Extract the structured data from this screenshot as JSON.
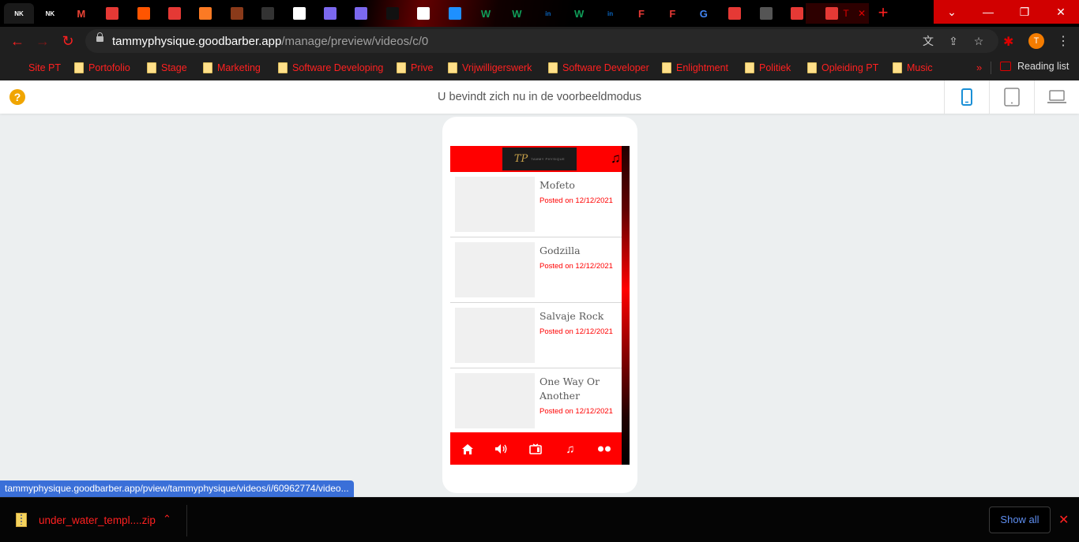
{
  "browser": {
    "tabs": [
      {
        "icon": "nkh-icon",
        "glyph": "NK",
        "color": "#ffffff"
      },
      {
        "icon": "nkh-icon",
        "glyph": "NK",
        "color": "#ffffff"
      },
      {
        "icon": "gmail-icon",
        "glyph": "M",
        "color": "#ea4335"
      },
      {
        "icon": "app-icon",
        "glyph": "",
        "color": "#e53935"
      },
      {
        "icon": "soundcloud-icon",
        "glyph": "",
        "color": "#ff5500"
      },
      {
        "icon": "app-icon",
        "glyph": "",
        "color": "#e53935"
      },
      {
        "icon": "xampp-icon",
        "glyph": "",
        "color": "#fb7a24"
      },
      {
        "icon": "bookmark-site-icon",
        "glyph": "",
        "color": "#8a3a1a"
      },
      {
        "icon": "dark-site-icon",
        "glyph": "",
        "color": "#333333"
      },
      {
        "icon": "github-icon",
        "glyph": "",
        "color": "#ffffff"
      },
      {
        "icon": "linear-icon",
        "glyph": "",
        "color": "#7b68ee"
      },
      {
        "icon": "linear-icon",
        "glyph": "",
        "color": "#7b68ee"
      },
      {
        "icon": "circle-icon",
        "glyph": "",
        "color": "#111111"
      },
      {
        "icon": "github-icon",
        "glyph": "",
        "color": "#ffffff"
      },
      {
        "icon": "drop-icon",
        "glyph": "",
        "color": "#1e90ff"
      },
      {
        "icon": "w-icon",
        "glyph": "W",
        "color": "#0f9d58"
      },
      {
        "icon": "w-icon",
        "glyph": "W",
        "color": "#0f9d58"
      },
      {
        "icon": "linkedin-icon",
        "glyph": "in",
        "color": "#0a66c2"
      },
      {
        "icon": "w-icon",
        "glyph": "W",
        "color": "#0f9d58"
      },
      {
        "icon": "linkedin-icon",
        "glyph": "in",
        "color": "#0a66c2"
      },
      {
        "icon": "f-icon",
        "glyph": "F",
        "color": "#e53935"
      },
      {
        "icon": "f-icon",
        "glyph": "F",
        "color": "#e53935"
      },
      {
        "icon": "google-icon",
        "glyph": "G",
        "color": "#4285f4"
      },
      {
        "icon": "record-icon",
        "glyph": "",
        "color": "#e53935"
      },
      {
        "icon": "loading-icon",
        "glyph": "",
        "color": "#555555"
      },
      {
        "icon": "app-icon",
        "glyph": "",
        "color": "#e53935"
      }
    ],
    "current_tab_label": "T",
    "url_host": "tammyphysique.goodbarber.app",
    "url_path": "/manage/preview/videos/c/0",
    "profile_initial": "T",
    "bookmarks": [
      "Site PT",
      "Portofolio",
      "Stage",
      "Marketing",
      "Software Developing",
      "Prive",
      "Vrijwilligerswerk",
      "Software Developer",
      "Enlightment",
      "Politiek",
      "Opleiding PT",
      "Music"
    ],
    "bookmarks_more": "»",
    "reading_list": "Reading list"
  },
  "preview": {
    "message": "U bevindt zich nu in de voorbeeldmodus",
    "help_icon": "?"
  },
  "app": {
    "logo_text": "TP",
    "logo_subtext": "TAMMY PHYSIQUE",
    "videos": [
      {
        "title": "Mofeto",
        "date": "Posted on 12/12/2021"
      },
      {
        "title": "Godzilla",
        "date": "Posted on 12/12/2021"
      },
      {
        "title": "Salvaje Rock",
        "date": "Posted on 12/12/2021"
      },
      {
        "title": "One Way Or Another",
        "date": "Posted on 12/12/2021"
      }
    ],
    "tabbar": [
      "home-icon",
      "speaker-icon",
      "video-icon",
      "music-icon",
      "flickr-icon"
    ]
  },
  "status_url": "tammyphysique.goodbarber.app/pview/tammyphysique/videos/i/60962774/video...",
  "downloads": {
    "file_name": "under_water_templ....zip",
    "show_all": "Show all"
  },
  "colors": {
    "accent": "#ff0000",
    "chrome_red": "#d10000",
    "link_blue": "#5e8ef0",
    "active_device": "#1a8fd6"
  }
}
